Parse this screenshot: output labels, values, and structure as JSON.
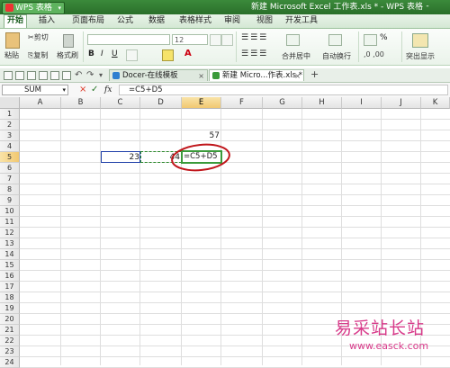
{
  "app": {
    "logo_label": "WPS 表格",
    "title": "新建 Microsoft Excel 工作表.xls * - WPS 表格",
    "minimize": "-"
  },
  "menu": {
    "tabs": [
      "开始",
      "插入",
      "页面布局",
      "公式",
      "数据",
      "表格样式",
      "审阅",
      "视图",
      "开发工具"
    ]
  },
  "ribbon": {
    "cut": "剪切",
    "paste": "粘贴",
    "copy": "复制",
    "format_painter": "格式刷",
    "font_size": "12",
    "merge_center": "合并居中",
    "wrap_text": "自动换行",
    "number_format": "%",
    "highlight": "突出显示"
  },
  "doc_tabs": [
    {
      "label": "Docer-在线模板",
      "closable": true,
      "active": false,
      "color": "#2f7fd0"
    },
    {
      "label": "新建 Micro...作表.xls *",
      "closable": true,
      "active": true,
      "color": "#3a9a3a"
    }
  ],
  "new_tab": "+",
  "formula_bar": {
    "name_box": "SUM",
    "cancel": "×",
    "confirm": "✓",
    "fx": "fx",
    "formula": "=C5+D5"
  },
  "grid": {
    "columns": [
      "A",
      "B",
      "C",
      "D",
      "E",
      "F",
      "G",
      "H",
      "I",
      "J",
      "K"
    ],
    "rows": [
      "1",
      "2",
      "3",
      "4",
      "5",
      "6",
      "7",
      "8",
      "9",
      "10",
      "11",
      "12",
      "13",
      "14",
      "15",
      "16",
      "17",
      "18",
      "19",
      "20",
      "21",
      "22",
      "23",
      "24"
    ],
    "selected_column": "E",
    "selected_row": "5",
    "cells": {
      "E3": "57",
      "C5": "23",
      "D5": "44",
      "E5": "=C5+D5"
    }
  },
  "watermark": {
    "text": "易采站长站",
    "url": "www.easck.com"
  },
  "colors": {
    "accent_green": "#2a6f2a",
    "ref_c5": "#1f3fa8",
    "ref_d5": "#2a8a2a",
    "annotation": "#c0161b",
    "watermark": "#d83a8a"
  }
}
